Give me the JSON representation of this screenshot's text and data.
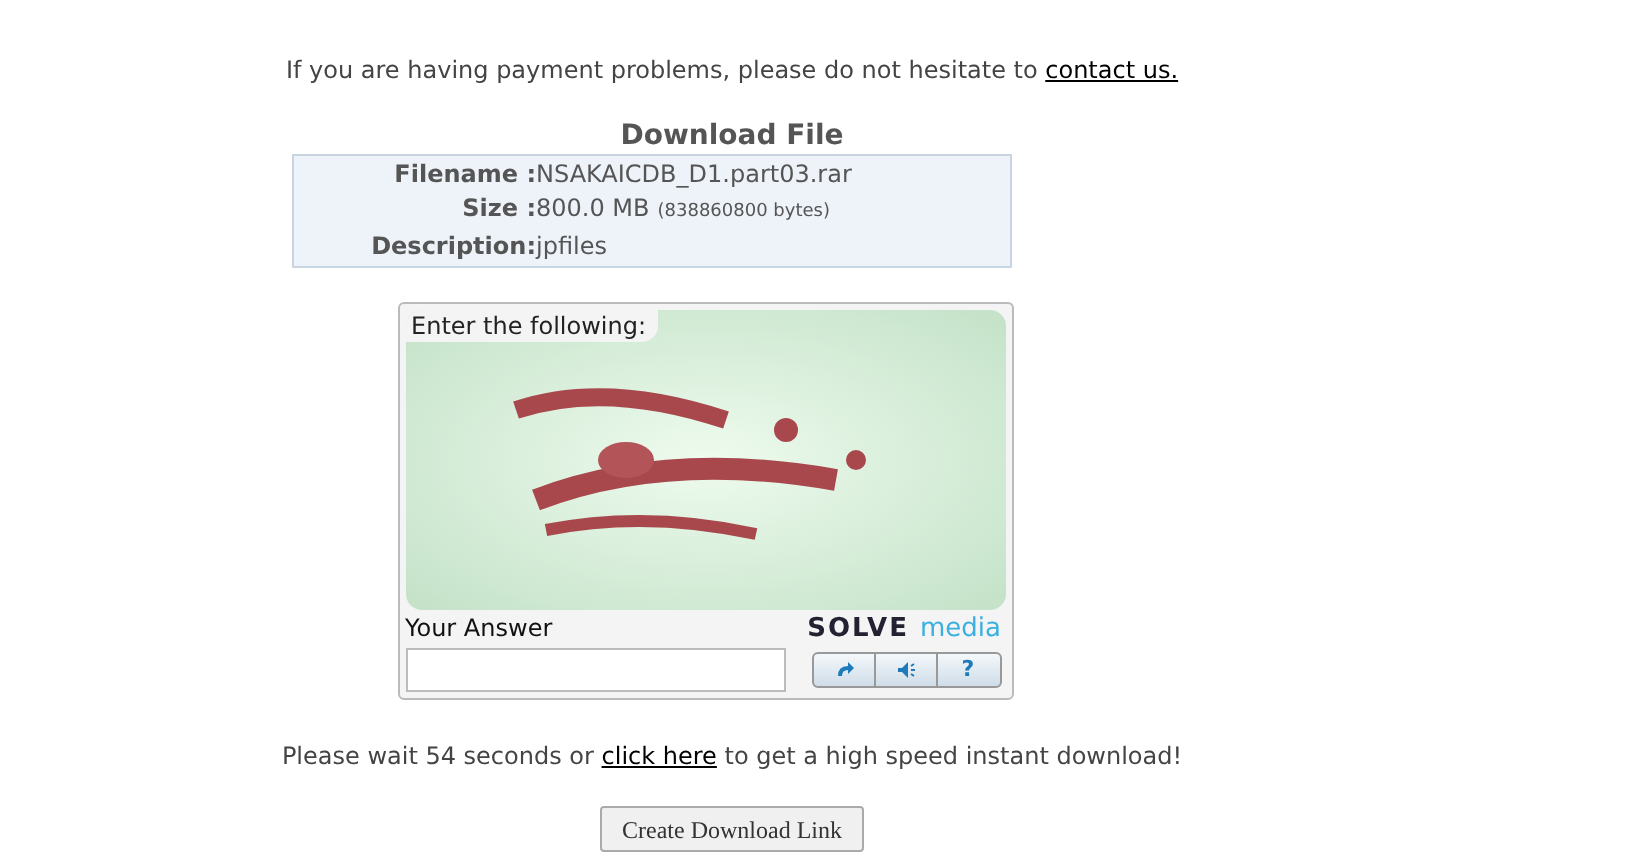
{
  "notice": {
    "text": "If you are having payment problems, please do not hesitate to ",
    "link": "contact us."
  },
  "download_file": {
    "title": "Download File",
    "rows": [
      {
        "label": "Filename :",
        "value": "NSAKAICDB_D1.part03.rar"
      },
      {
        "label": "Size :",
        "value": "800.0 MB",
        "note": "(838860800 bytes)"
      },
      {
        "label": "Description:",
        "value": "jpfiles"
      }
    ]
  },
  "captcha": {
    "prompt": "Enter the following:",
    "image": {
      "kind": "picture"
    },
    "answer_label": "Your Answer",
    "logo": [
      "SOLVE",
      "media"
    ],
    "help_button": "?"
  },
  "wait_notice": {
    "before": "Please wait 54 seconds or ",
    "link": "click here",
    "after": " to get a high speed instant download!"
  },
  "button": "Create Download Link"
}
